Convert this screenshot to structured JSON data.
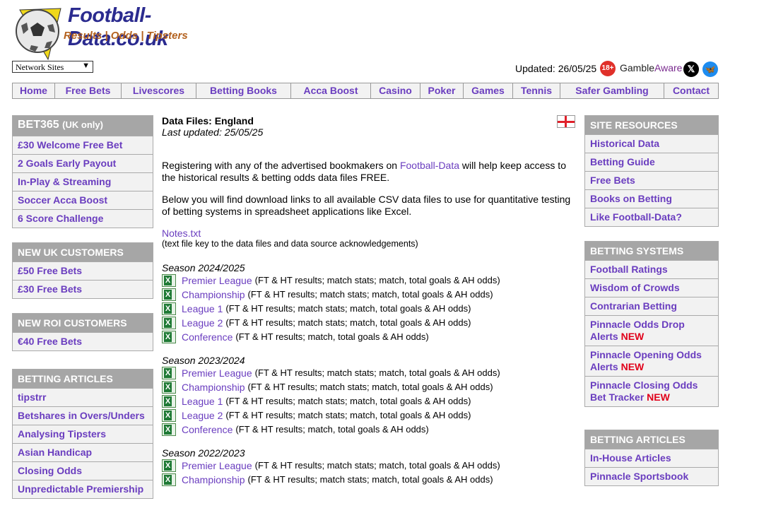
{
  "header": {
    "logo_title": "Football-Data.co.uk",
    "logo_subtitle": "Results | Odds | Tipsters",
    "network_select": "Network Sites",
    "updated": "Updated: 26/05/25",
    "age_badge": "18+",
    "gamble_aware_a": "Gamble",
    "gamble_aware_b": "Aware"
  },
  "nav": [
    {
      "label": "Home"
    },
    {
      "label": "Free Bets"
    },
    {
      "label": "Livescores"
    },
    {
      "label": "Betting Books"
    },
    {
      "label": "Acca Boost"
    },
    {
      "label": "Casino"
    },
    {
      "label": "Poker"
    },
    {
      "label": "Games"
    },
    {
      "label": "Tennis"
    },
    {
      "label": "Safer Gambling"
    },
    {
      "label": "Contact"
    }
  ],
  "left": {
    "bet365": {
      "head": "BET365",
      "head_small": "(UK only)",
      "items": [
        "£30 Welcome Free Bet",
        "2 Goals Early Payout",
        "In-Play & Streaming",
        "Soccer Acca Boost",
        "6 Score Challenge"
      ]
    },
    "uk": {
      "head": "NEW UK CUSTOMERS",
      "items": [
        "£50 Free Bets",
        "£30 Free Bets"
      ]
    },
    "roi": {
      "head": "NEW ROI CUSTOMERS",
      "items": [
        "€40 Free Bets"
      ]
    },
    "articles": {
      "head": "BETTING ARTICLES",
      "items": [
        "tipstrr",
        "Betshares in Overs/Unders",
        "Analysing Tipsters",
        "Asian Handicap",
        "Closing Odds",
        "Unpredictable Premiership"
      ]
    }
  },
  "main": {
    "title": "Data Files: England",
    "last_updated": "Last updated: 25/05/25",
    "para1_a": "Registering with any of the advertised bookmakers on ",
    "para1_link": "Football-Data",
    "para1_b": " will help keep access to the historical results & betting odds data files FREE.",
    "para2": "Below you will find download links to all available CSV data files to use for quantitative testing of betting systems in spreadsheet applications like Excel.",
    "notes_link": "Notes.txt",
    "notes_desc": "(text file key to the data files and data source acknowledgements)",
    "seasons": [
      {
        "label": "Season 2024/2025",
        "files": [
          {
            "name": "Premier League",
            "desc": "(FT & HT results; match stats; match, total goals & AH odds)"
          },
          {
            "name": "Championship",
            "desc": "(FT & HT results; match stats; match, total goals & AH odds)"
          },
          {
            "name": "League 1",
            "desc": "(FT & HT results; match stats; match, total goals & AH odds)"
          },
          {
            "name": "League 2",
            "desc": "(FT & HT results; match stats; match, total goals & AH odds)"
          },
          {
            "name": "Conference",
            "desc": "(FT & HT results; match, total goals & AH odds)"
          }
        ]
      },
      {
        "label": "Season 2023/2024",
        "files": [
          {
            "name": "Premier League",
            "desc": "(FT & HT results; match stats; match, total goals & AH odds)"
          },
          {
            "name": "Championship",
            "desc": "(FT & HT results; match stats; match, total goals & AH odds)"
          },
          {
            "name": "League 1",
            "desc": "(FT & HT results; match stats; match, total goals & AH odds)"
          },
          {
            "name": "League 2",
            "desc": "(FT & HT results; match stats; match, total goals & AH odds)"
          },
          {
            "name": "Conference",
            "desc": "(FT & HT results; match, total goals & AH odds)"
          }
        ]
      },
      {
        "label": "Season 2022/2023",
        "files": [
          {
            "name": "Premier League",
            "desc": "(FT & HT results; match stats; match, total goals & AH odds)"
          },
          {
            "name": "Championship",
            "desc": "(FT & HT results; match stats; match, total goals & AH odds)"
          }
        ]
      }
    ]
  },
  "right": {
    "resources": {
      "head": "SITE RESOURCES",
      "items": [
        "Historical Data",
        "Betting Guide",
        "Free Bets",
        "Books on Betting",
        "Like Football-Data?"
      ]
    },
    "systems": {
      "head": "BETTING SYSTEMS",
      "new_label": "NEW",
      "items": [
        "Football Ratings",
        "Wisdom of Crowds",
        "Contrarian Betting"
      ],
      "new_items": [
        {
          "l1": "Pinnacle Odds Drop",
          "l2": "Alerts"
        },
        {
          "l1": "Pinnacle Opening Odds",
          "l2": "Alerts"
        },
        {
          "l1": "Pinnacle Closing Odds",
          "l2": "Bet Tracker"
        }
      ]
    },
    "articles": {
      "head": "BETTING ARTICLES",
      "items": [
        "In-House Articles",
        "Pinnacle Sportsbook"
      ]
    }
  },
  "colors": {
    "link": "#6a3dbf",
    "box_header": "#a6a6a6",
    "new": "#e0001a"
  }
}
